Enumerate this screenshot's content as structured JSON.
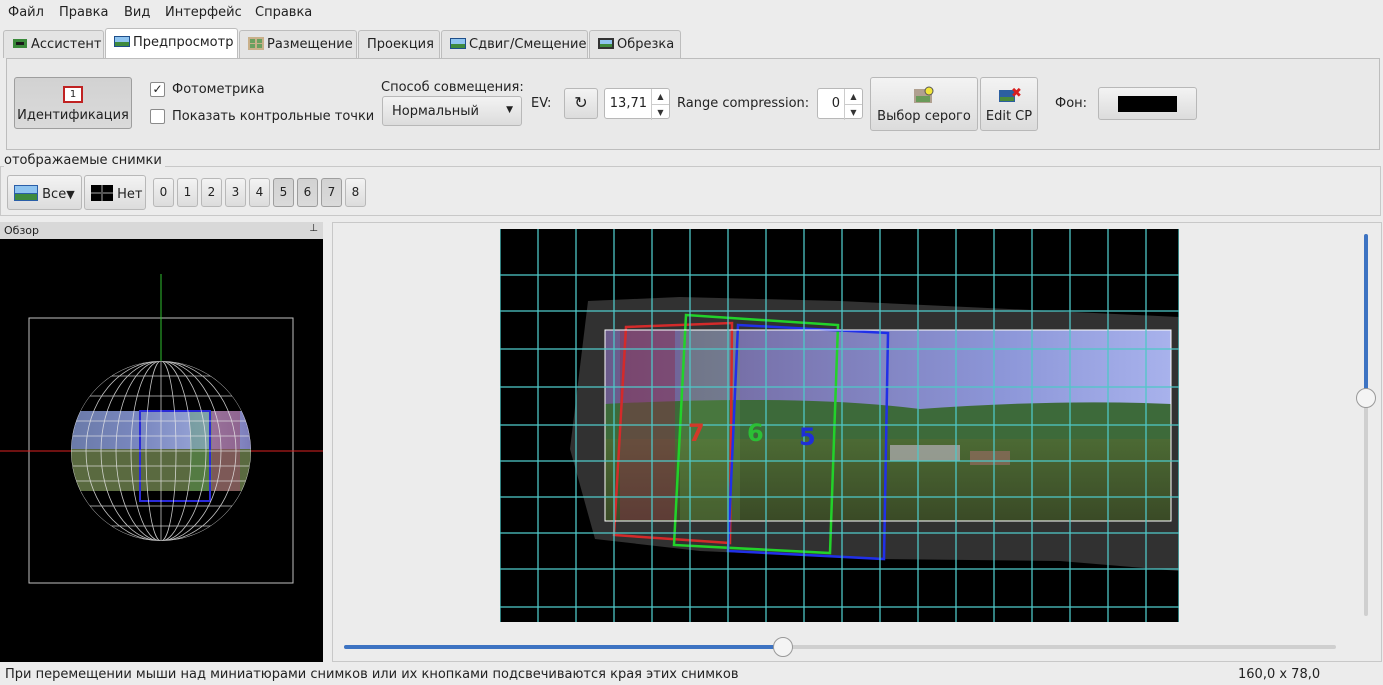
{
  "menu": [
    "Файл",
    "Правка",
    "Вид",
    "Интерфейс",
    "Справка"
  ],
  "tabs": [
    {
      "label": "Ассистент",
      "icon": "assistant-icon"
    },
    {
      "label": "Предпросмотр",
      "icon": "preview-icon"
    },
    {
      "label": "Размещение",
      "icon": "layout-icon"
    },
    {
      "label": "Проекция",
      "icon": ""
    },
    {
      "label": "Сдвиг/Смещение",
      "icon": "move-icon"
    },
    {
      "label": "Обрезка",
      "icon": "crop-icon"
    }
  ],
  "toolbar": {
    "identify_label": "Идентификация",
    "identify_badge": "1",
    "photometric_label": "Фотометрика",
    "photometric_checked": true,
    "show_cp_label": "Показать контрольные точки",
    "show_cp_checked": false,
    "blend_mode_label": "Способ совмещения:",
    "blend_mode_value": "Нормальный",
    "ev_label": "EV:",
    "ev_value": "13,71",
    "range_label": "Range compression:",
    "range_value": "0",
    "gray_label": "Выбор серого",
    "editcp_label": "Edit CP",
    "bg_label": "Фон:",
    "bg_color": "#000000"
  },
  "images": {
    "section_label": "отображаемые снимки",
    "all_label": "Все",
    "none_label": "Нет",
    "numbers": [
      "0",
      "1",
      "2",
      "3",
      "4",
      "5",
      "6",
      "7",
      "8"
    ]
  },
  "overview": {
    "title": "Обзор"
  },
  "preview": {
    "labels": [
      {
        "text": "7",
        "color": "#d23a2a"
      },
      {
        "text": "6",
        "color": "#2bbf35"
      },
      {
        "text": "5",
        "color": "#1f2fd8"
      }
    ],
    "grid_color": "#4fc8c8"
  },
  "status": {
    "message": "При перемещении мыши над миниатюрами снимков или их кнопками подсвечиваются края этих снимков",
    "fov": "160,0 x 78,0"
  }
}
